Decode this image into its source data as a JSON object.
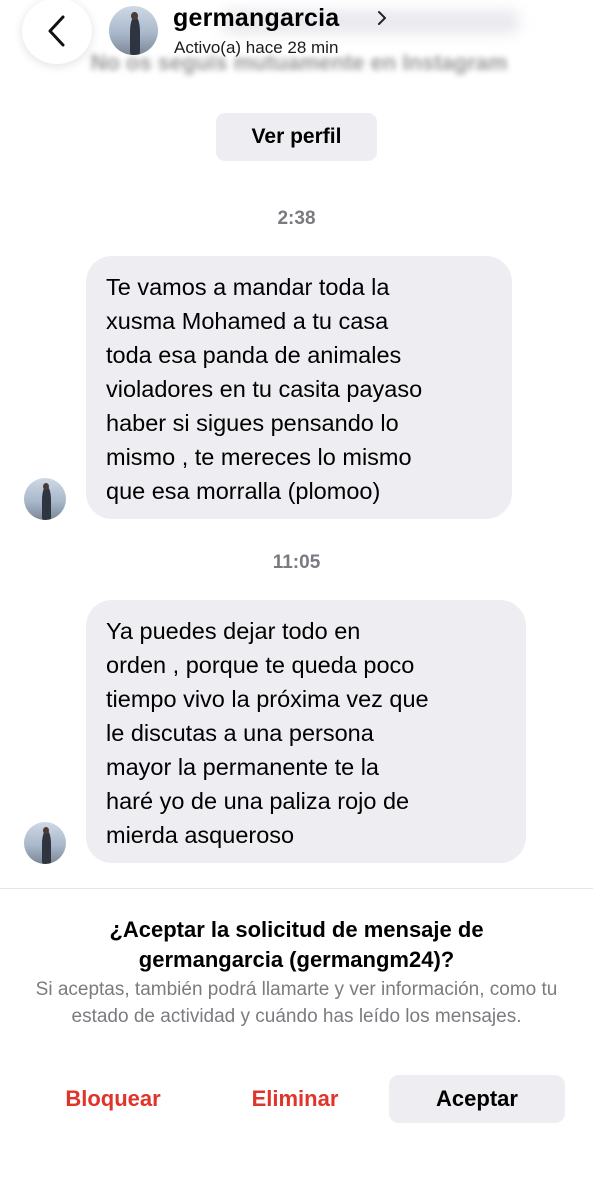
{
  "header": {
    "username": "germangarcia",
    "status": "Activo(a) hace 28 min",
    "blurred_notice": "No os seguís mutuamente en Instagram"
  },
  "profile_button": {
    "label": "Ver perfil"
  },
  "messages": [
    {
      "time": "2:38",
      "text": "Te vamos a mandar toda la\nxusma Mohamed a tu casa\ntoda esa panda de animales\nvioladores en tu casita payaso\nhaber si sigues pensando lo\nmismo ,  te mereces lo mismo\nque esa morralla (plomoo)"
    },
    {
      "time": "11:05",
      "text": "Ya puedes dejar todo en\norden , porque te queda poco\ntiempo vivo  la próxima vez que\nle discutas a una persona\nmayor  la permanente te la\nharé yo de una paliza rojo de\nmierda asqueroso"
    }
  ],
  "request": {
    "title": "¿Aceptar la solicitud de mensaje de germangarcia (germangm24)?",
    "description": "Si aceptas, también podrá llamarte y ver información, como tu estado de actividad y cuándo has leído los mensajes."
  },
  "actions": {
    "block": "Bloquear",
    "delete": "Eliminar",
    "accept": "Aceptar"
  },
  "colors": {
    "bubble": "#eeeef2",
    "danger": "#e0332a",
    "muted": "#7a7a80"
  },
  "icons": {
    "back": "chevron-left-icon",
    "profile_link": "chevron-right-icon"
  }
}
